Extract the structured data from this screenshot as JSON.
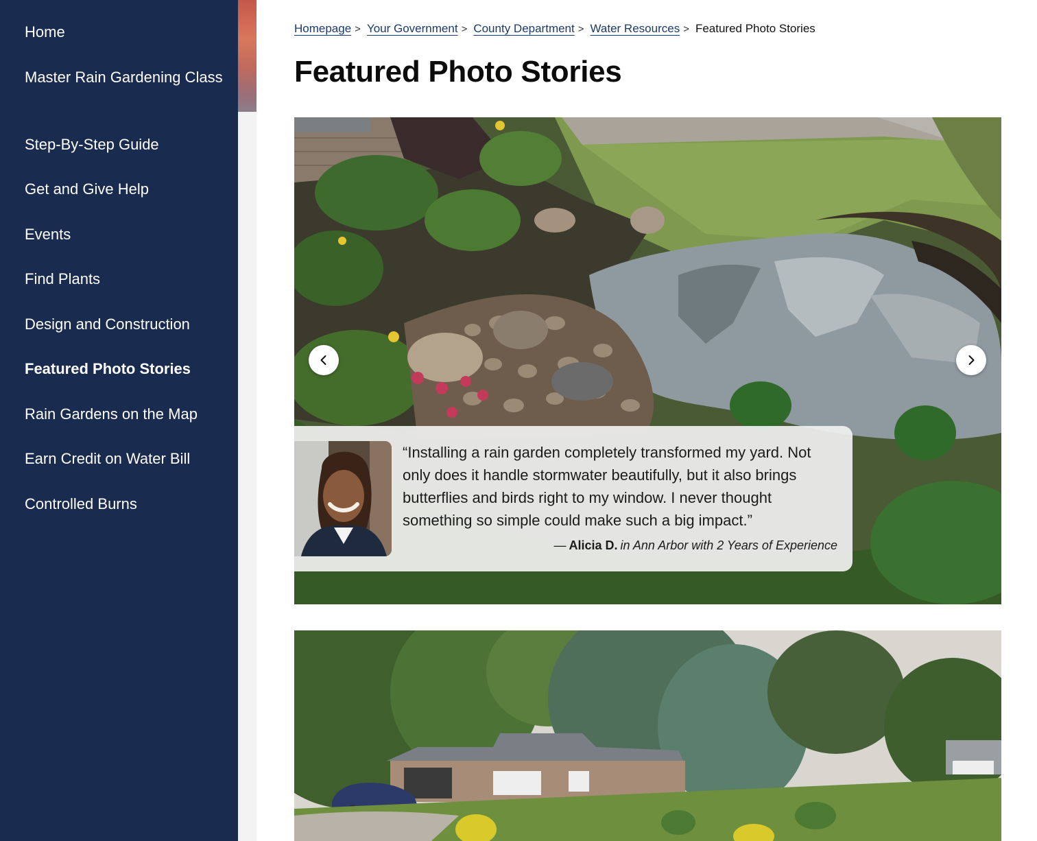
{
  "sidebar": {
    "items": [
      {
        "label": "Home"
      },
      {
        "label": "Master Rain Gardening Class"
      },
      {
        "label": "Step-By-Step Guide"
      },
      {
        "label": "Get and Give Help"
      },
      {
        "label": "Events"
      },
      {
        "label": "Find Plants"
      },
      {
        "label": "Design and Construction"
      },
      {
        "label": "Featured Photo Stories",
        "active": true
      },
      {
        "label": "Rain Gardens on the Map"
      },
      {
        "label": "Earn Credit on Water Bill"
      },
      {
        "label": "Controlled Burns"
      }
    ]
  },
  "breadcrumb": {
    "items": [
      "Homepage",
      "Your Government",
      "County Department",
      "Water Resources"
    ],
    "separator": ">",
    "current": "Featured Photo Stories"
  },
  "page": {
    "title": "Featured Photo Stories"
  },
  "carousel": {
    "prev_icon": "chevron-left-icon",
    "next_icon": "chevron-right-icon"
  },
  "testimonial": {
    "quote": "“Installing a rain garden completely transformed my yard. Not only does it handle stormwater beautifully, but it also brings butterflies and birds right to my window. I never thought something so simple could make such a big impact.”",
    "dash": "—",
    "name": "Alicia D.",
    "detail": "in Ann Arbor with 2 Years of Experience"
  },
  "colors": {
    "sidebar_bg": "#1a2b50",
    "link": "#1a3a6a",
    "card_bg": "#f0f0f0"
  }
}
